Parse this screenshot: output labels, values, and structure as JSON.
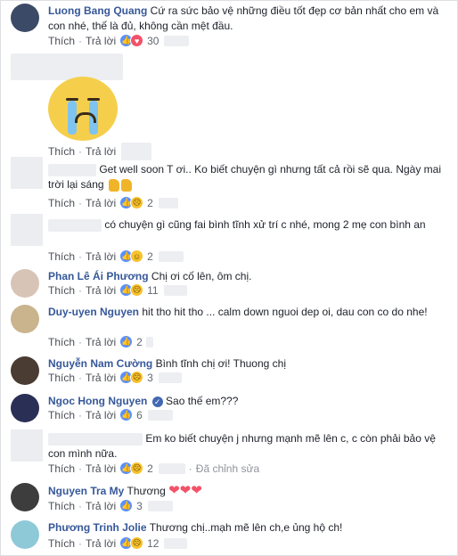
{
  "actions": {
    "like": "Thích",
    "reply": "Trả lời",
    "edited": "Đã chỉnh sửa",
    "sep": "·"
  },
  "comments": [
    {
      "name": "Luong Bang Quang",
      "text": "Cứ ra sức bảo vệ những điều tốt đẹp cơ bản nhất cho em và con nhé, thế là đủ, không cần mệt đầu.",
      "reactions": [
        "like",
        "love"
      ],
      "count": "30"
    },
    {
      "name": "",
      "text": "",
      "reactions": [],
      "count": ""
    },
    {
      "name": "",
      "text": "Get well soon T ơi.. Ko biết chuyện gì nhưng tất cả rồi sẽ qua. Ngày mai trời lại sáng",
      "reactions": [
        "like",
        "sad"
      ],
      "count": "2"
    },
    {
      "name": "",
      "text": "có chuyện gì cũng fai bình tĩnh xử trí c nhé, mong 2 mẹ con bình an",
      "reactions": [
        "like",
        "haha"
      ],
      "count": "2"
    },
    {
      "name": "Phan Lê Ái Phương",
      "text": "Chị ơi cố lên, ôm chị.",
      "reactions": [
        "like",
        "sad"
      ],
      "count": "11"
    },
    {
      "name": "Duy-uyen Nguyen",
      "text": "hit tho hit tho ... calm down nguoi dep oi, dau con co do nhe!",
      "reactions": [
        "like"
      ],
      "count": "2"
    },
    {
      "name": "Nguyễn Nam Cường",
      "text": "Bình tĩnh chị ơi! Thuong chị",
      "reactions": [
        "like",
        "sad"
      ],
      "count": "3"
    },
    {
      "name": "Ngoc Hong Nguyen",
      "text": "Sao thế em???",
      "reactions": [
        "like"
      ],
      "count": "6"
    },
    {
      "name": "",
      "text": "Em ko biết chuyện j nhưng mạnh mẽ lên c, c còn phải bảo vệ con mình nữa.",
      "reactions": [
        "like",
        "sad"
      ],
      "count": "2"
    },
    {
      "name": "Nguyen Tra My",
      "text": "Thương",
      "reactions": [
        "like"
      ],
      "count": "3"
    },
    {
      "name": "Phương Trinh Jolie",
      "text": "Thương chị..mạh mẽ lên ch,e ủng hộ ch!",
      "reactions": [
        "like",
        "sad"
      ],
      "count": "12"
    }
  ],
  "icons": [
    "verified-badge-icon",
    "like-reaction-icon",
    "love-reaction-icon",
    "sad-reaction-icon",
    "haha-reaction-icon",
    "heart-emoji-icon",
    "crying-sticker-icon",
    "flexed-biceps-emoji-icon"
  ],
  "colors": {
    "name": "#365899",
    "meta": "#4b4f56",
    "like": "#5890ff",
    "love": "#f25268",
    "verified": "#4267b2"
  }
}
